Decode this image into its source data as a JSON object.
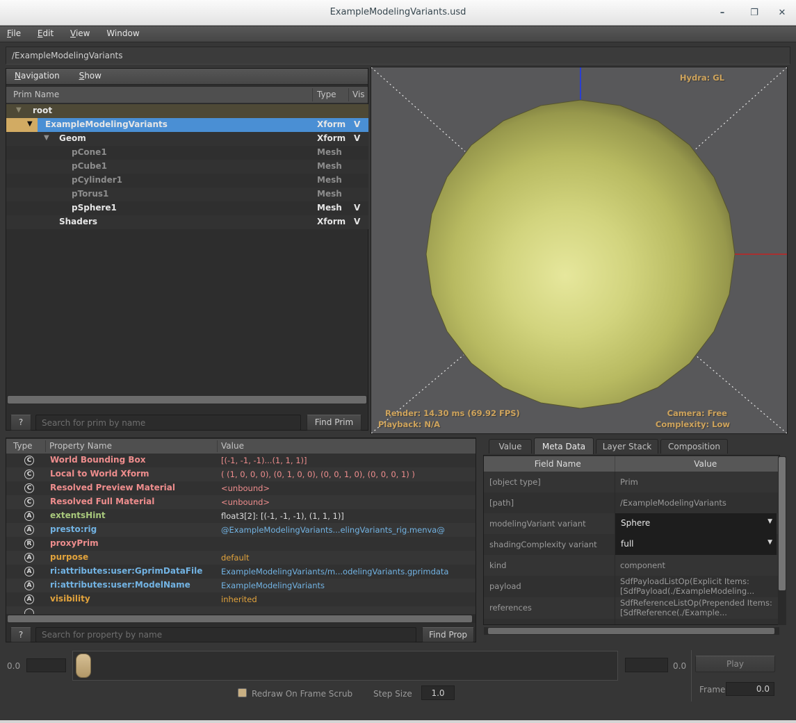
{
  "window": {
    "title": "ExampleModelingVariants.usd",
    "minimize": "–",
    "maximize": "❐",
    "close": "✕"
  },
  "menubar": {
    "items": [
      "File",
      "Edit",
      "View",
      "Window"
    ]
  },
  "pathbar": {
    "value": "/ExampleModelingVariants"
  },
  "tree": {
    "menu": [
      "Navigation",
      "Show"
    ],
    "columns": [
      "Prim Name",
      "Type",
      "Vis"
    ],
    "rows": [
      {
        "name": "root",
        "type": "",
        "vis": ""
      },
      {
        "name": "ExampleModelingVariants",
        "type": "Xform",
        "vis": "V"
      },
      {
        "name": "Geom",
        "type": "Xform",
        "vis": "V"
      },
      {
        "name": "pCone1",
        "type": "Mesh",
        "vis": ""
      },
      {
        "name": "pCube1",
        "type": "Mesh",
        "vis": ""
      },
      {
        "name": "pCylinder1",
        "type": "Mesh",
        "vis": ""
      },
      {
        "name": "pTorus1",
        "type": "Mesh",
        "vis": ""
      },
      {
        "name": "pSphere1",
        "type": "Mesh",
        "vis": "V"
      },
      {
        "name": "Shaders",
        "type": "Xform",
        "vis": "V"
      }
    ],
    "search": {
      "help": "?",
      "placeholder": "Search for prim by name",
      "button": "Find Prim"
    }
  },
  "viewport": {
    "renderer": "Hydra: GL",
    "render_stats": "Render: 14.30 ms (69.92 FPS)",
    "playback": "Playback: N/A",
    "camera": "Camera: Free",
    "complexity": "Complexity: Low"
  },
  "properties": {
    "columns": [
      "Type",
      "Property Name",
      "Value"
    ],
    "rows": [
      {
        "icon": "C",
        "name": "World Bounding Box",
        "value": "[(-1, -1, -1)...(1, 1, 1)]"
      },
      {
        "icon": "C",
        "name": "Local to World Xform",
        "value": "( (1, 0, 0, 0), (0, 1, 0, 0), (0, 0, 1, 0), (0, 0, 0, 1) )"
      },
      {
        "icon": "C",
        "name": "Resolved Preview Material",
        "value": "<unbound>"
      },
      {
        "icon": "C",
        "name": "Resolved Full Material",
        "value": "<unbound>"
      },
      {
        "icon": "A",
        "name": "extentsHint",
        "value": "float3[2]: [(-1, -1, -1), (1, 1, 1)]"
      },
      {
        "icon": "A",
        "name": "presto:rig",
        "value": "@ExampleModelingVariants...elingVariants_rig.menva@"
      },
      {
        "icon": "R",
        "name": "proxyPrim",
        "value": ""
      },
      {
        "icon": "A",
        "name": "purpose",
        "value": "default"
      },
      {
        "icon": "A",
        "name": "ri:attributes:user:GprimDataFile",
        "value": "ExampleModelingVariants/m...odelingVariants.gprimdata"
      },
      {
        "icon": "A",
        "name": "ri:attributes:user:ModelName",
        "value": "ExampleModelingVariants"
      },
      {
        "icon": "A",
        "name": "visibility",
        "value": "inherited"
      }
    ],
    "search": {
      "help": "?",
      "placeholder": "Search for property by name",
      "button": "Find Prop"
    }
  },
  "metadata": {
    "tabs": [
      "Value",
      "Meta Data",
      "Layer Stack",
      "Composition"
    ],
    "active_tab": "Meta Data",
    "columns": [
      "Field Name",
      "Value"
    ],
    "rows": [
      {
        "field": "[object type]",
        "value": "Prim"
      },
      {
        "field": "[path]",
        "value": "/ExampleModelingVariants"
      },
      {
        "field": "modelingVariant variant",
        "value": "Sphere"
      },
      {
        "field": "shadingComplexity variant",
        "value": "full"
      },
      {
        "field": "kind",
        "value": "component"
      },
      {
        "field": "payload",
        "value": "SdfPayloadListOp(Explicit Items: [SdfPayload(./ExampleModeling..."
      },
      {
        "field": "references",
        "value": "SdfReferenceListOp(Prepended Items: [SdfReference(./Example..."
      }
    ]
  },
  "timeline": {
    "start_label": "0.0",
    "end_label": "0.0",
    "play": "Play",
    "frame_label": "Frame:",
    "frame_value": "0.0",
    "redraw_label": "Redraw On Frame Scrub",
    "step_label": "Step Size",
    "step_value": "1.0"
  },
  "colors": {
    "selection_blue": "#4a8fd4",
    "selection_indent_tan": "#d2ab63",
    "root_row_olive": "#4e4936",
    "hud_text": "#cfa45c",
    "prop_computed": "#ee8d8d",
    "prop_attr_green": "#a9c97c",
    "prop_attr_blue": "#72b3e3",
    "prop_attr_orange": "#e2a33c",
    "sphere_highlight": "#e6e79c",
    "sphere_mid": "#c2c46a",
    "sphere_edge": "#6f6e3a",
    "viewport_bg": "#58585a",
    "handle_tan": "#c9b083"
  }
}
